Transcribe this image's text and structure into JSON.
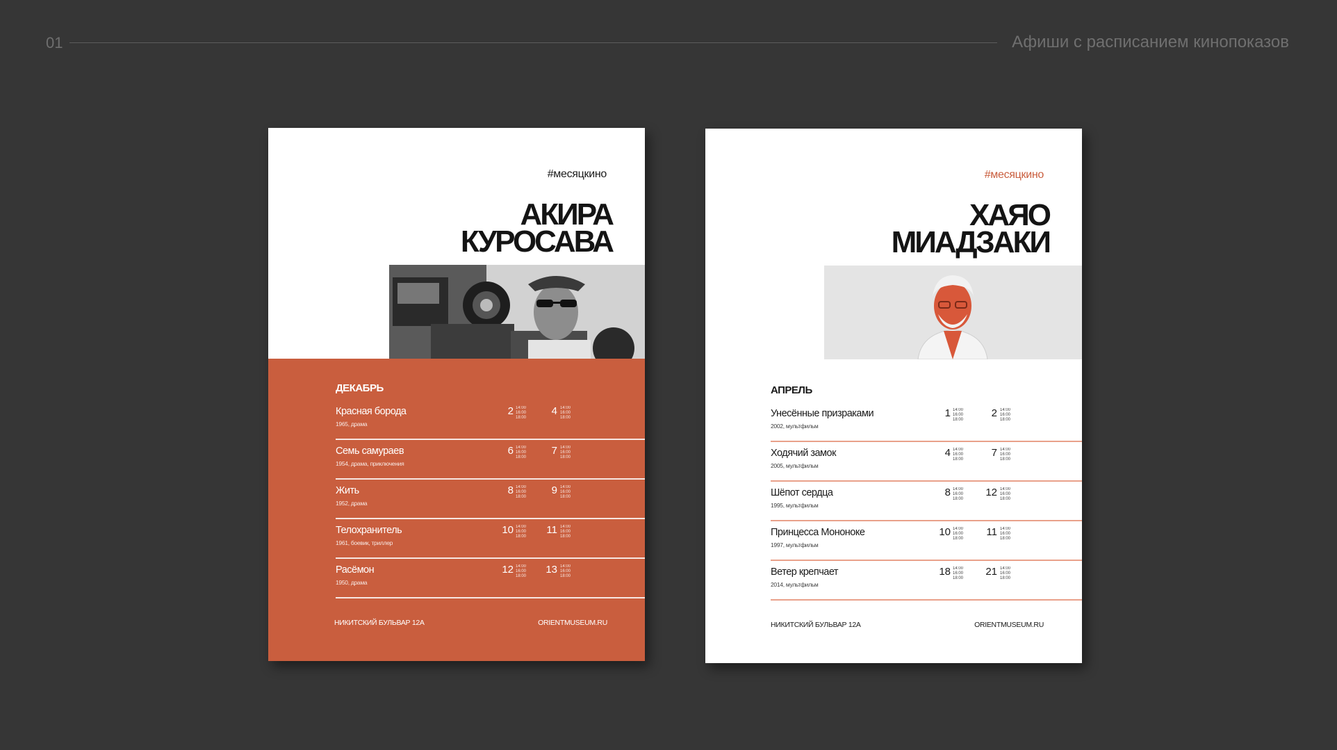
{
  "header": {
    "slide_number": "01",
    "title": "Афиши с расписанием кинопоказов"
  },
  "colors": {
    "background": "#363636",
    "accent": "#c95e3e",
    "poster_bg": "#ffffff"
  },
  "posters": [
    {
      "hashtag": "#месяцкино",
      "name_line1": "АКИРА",
      "name_line2": "КУРОСАВА",
      "photo_icon": "director-photo-kurosawa",
      "month": "ДЕКАБРЬ",
      "films": [
        {
          "title": "Красная борода",
          "meta": "1965, драма",
          "date1": "2",
          "date2": "4"
        },
        {
          "title": "Семь самураев",
          "meta": "1954, драма, приключения",
          "date1": "6",
          "date2": "7"
        },
        {
          "title": "Жить",
          "meta": "1952, драма",
          "date1": "8",
          "date2": "9"
        },
        {
          "title": "Телохранитель",
          "meta": "1961, боевик, триллер",
          "date1": "10",
          "date2": "11"
        },
        {
          "title": "Расёмон",
          "meta": "1950, драма",
          "date1": "12",
          "date2": "13"
        }
      ],
      "times": [
        "14:00",
        "16:00",
        "18:00"
      ],
      "address": "НИКИТСКИЙ БУЛЬВАР 12А",
      "site": "ORIENTMUSEUM.RU"
    },
    {
      "hashtag": "#месяцкино",
      "name_line1": "ХАЯО",
      "name_line2": "МИАДЗАКИ",
      "photo_icon": "director-photo-miyazaki",
      "month": "АПРЕЛЬ",
      "films": [
        {
          "title": "Унесённые призраками",
          "meta": "2002, мультфильм",
          "date1": "1",
          "date2": "2"
        },
        {
          "title": "Ходячий замок",
          "meta": "2005, мультфильм",
          "date1": "4",
          "date2": "7"
        },
        {
          "title": "Шёпот сердца",
          "meta": "1995, мультфильм",
          "date1": "8",
          "date2": "12"
        },
        {
          "title": "Принцесса Мононоке",
          "meta": "1997, мультфильм",
          "date1": "10",
          "date2": "11"
        },
        {
          "title": "Ветер крепчает",
          "meta": "2014, мультфильм",
          "date1": "18",
          "date2": "21"
        }
      ],
      "times": [
        "14:00",
        "16:00",
        "18:00"
      ],
      "address": "НИКИТСКИЙ БУЛЬВАР 12А",
      "site": "ORIENTMUSEUM.RU"
    }
  ]
}
